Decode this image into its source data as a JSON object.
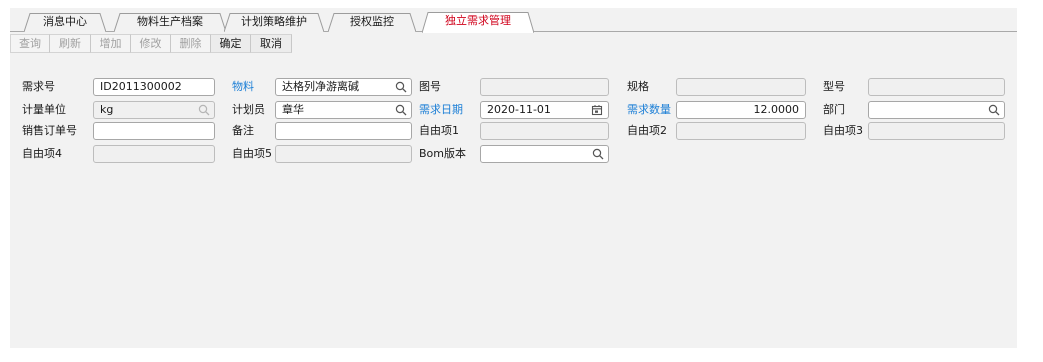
{
  "tabs": [
    {
      "label": "消息中心",
      "active": false
    },
    {
      "label": "物料生产档案",
      "active": false
    },
    {
      "label": "计划策略维护",
      "active": false
    },
    {
      "label": "授权监控",
      "active": false
    },
    {
      "label": "独立需求管理",
      "active": true
    }
  ],
  "toolbar": {
    "query": "查询",
    "refresh": "刷新",
    "add": "增加",
    "edit": "修改",
    "delete": "删除",
    "confirm": "确定",
    "cancel": "取消"
  },
  "form": {
    "demand_no": {
      "label": "需求号",
      "value": "ID2011300002"
    },
    "material": {
      "label": "物料",
      "value": "达格列净游离碱"
    },
    "drawing_no": {
      "label": "图号",
      "value": ""
    },
    "spec": {
      "label": "规格",
      "value": ""
    },
    "model": {
      "label": "型号",
      "value": ""
    },
    "unit": {
      "label": "计量单位",
      "value": "kg"
    },
    "planner": {
      "label": "计划员",
      "value": "章华"
    },
    "demand_date": {
      "label": "需求日期",
      "value": "2020-11-01"
    },
    "demand_qty": {
      "label": "需求数量",
      "value": "12.0000"
    },
    "department": {
      "label": "部门",
      "value": ""
    },
    "sales_order": {
      "label": "销售订单号",
      "value": ""
    },
    "remark": {
      "label": "备注",
      "value": ""
    },
    "custom1": {
      "label": "自由项1",
      "value": ""
    },
    "custom2": {
      "label": "自由项2",
      "value": ""
    },
    "custom3": {
      "label": "自由项3",
      "value": ""
    },
    "custom4": {
      "label": "自由项4",
      "value": ""
    },
    "custom5": {
      "label": "自由项5",
      "value": ""
    },
    "bom_version": {
      "label": "Bom版本",
      "value": ""
    }
  },
  "colors": {
    "required_label": "#1c7fd6",
    "active_tab": "#d0021b"
  }
}
